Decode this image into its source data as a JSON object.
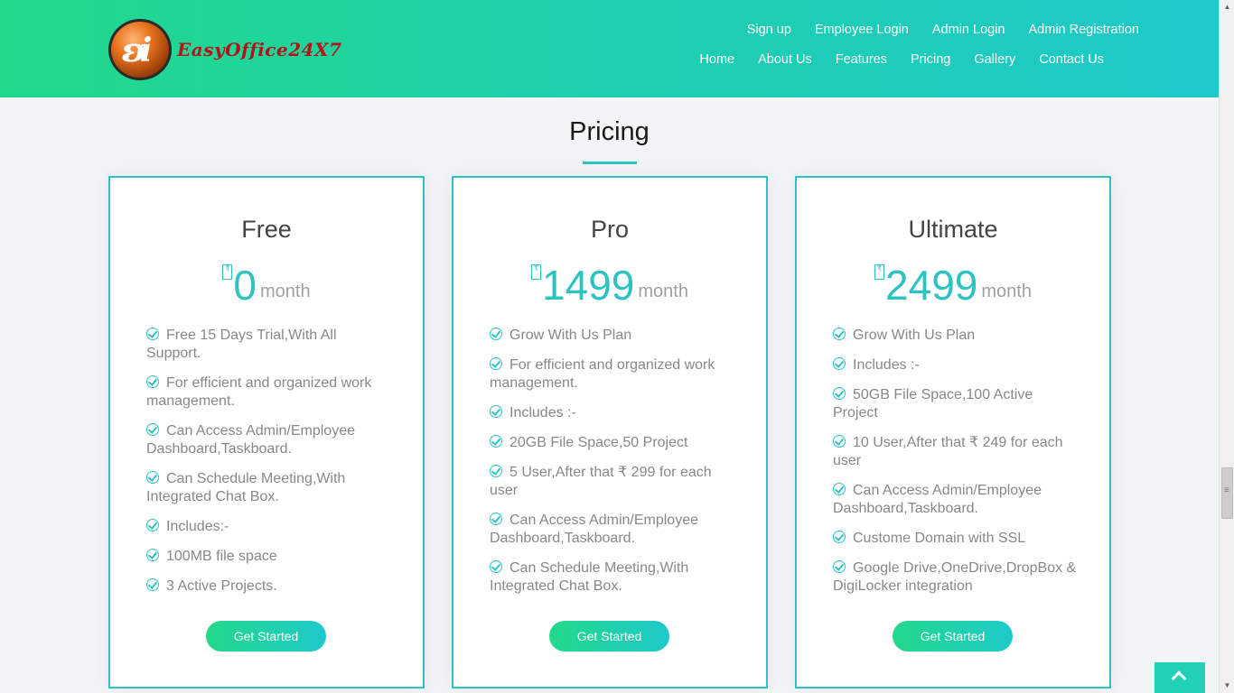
{
  "brand": {
    "logo_text": "EasyOffice24X7"
  },
  "top_nav": [
    "Sign up",
    "Employee Login",
    "Admin Login",
    "Admin Registration"
  ],
  "main_nav": [
    "Home",
    "About Us",
    "Features",
    "Pricing",
    "Gallery",
    "Contact Us"
  ],
  "section_title": "Pricing",
  "colors": {
    "accent": "#2cc4c2",
    "header_start": "#22d98a",
    "header_end": "#1ec9c9"
  },
  "plans": [
    {
      "name": "Free",
      "currency_icon": "rupee-icon",
      "price": "0",
      "period": "month",
      "features": [
        "Free 15 Days Trial,With All Support.",
        "For efficient and organized work management.",
        "Can Access Admin/Employee Dashboard,Taskboard.",
        "Can Schedule Meeting,With Integrated Chat Box.",
        "Includes:-",
        "100MB file space",
        "3 Active Projects."
      ],
      "cta": "Get Started"
    },
    {
      "name": "Pro",
      "currency_icon": "rupee-icon",
      "price": "1499",
      "period": "month",
      "features": [
        "Grow With Us Plan",
        "For efficient and organized work management.",
        "Includes :-",
        "20GB File Space,50 Project",
        "5 User,After that ₹ 299 for each user",
        "Can Access Admin/Employee Dashboard,Taskboard.",
        "Can Schedule Meeting,With Integrated Chat Box."
      ],
      "cta": "Get Started"
    },
    {
      "name": "Ultimate",
      "currency_icon": "rupee-icon",
      "price": "2499",
      "period": "month",
      "features": [
        "Grow With Us Plan",
        "Includes :-",
        "50GB File Space,100 Active Project",
        "10 User,After that ₹ 249 for each user",
        "Can Access Admin/Employee Dashboard,Taskboard.",
        "Custome Domain with SSL",
        "Google Drive,OneDrive,DropBox & DigiLocker integration"
      ],
      "cta": "Get Started"
    }
  ]
}
